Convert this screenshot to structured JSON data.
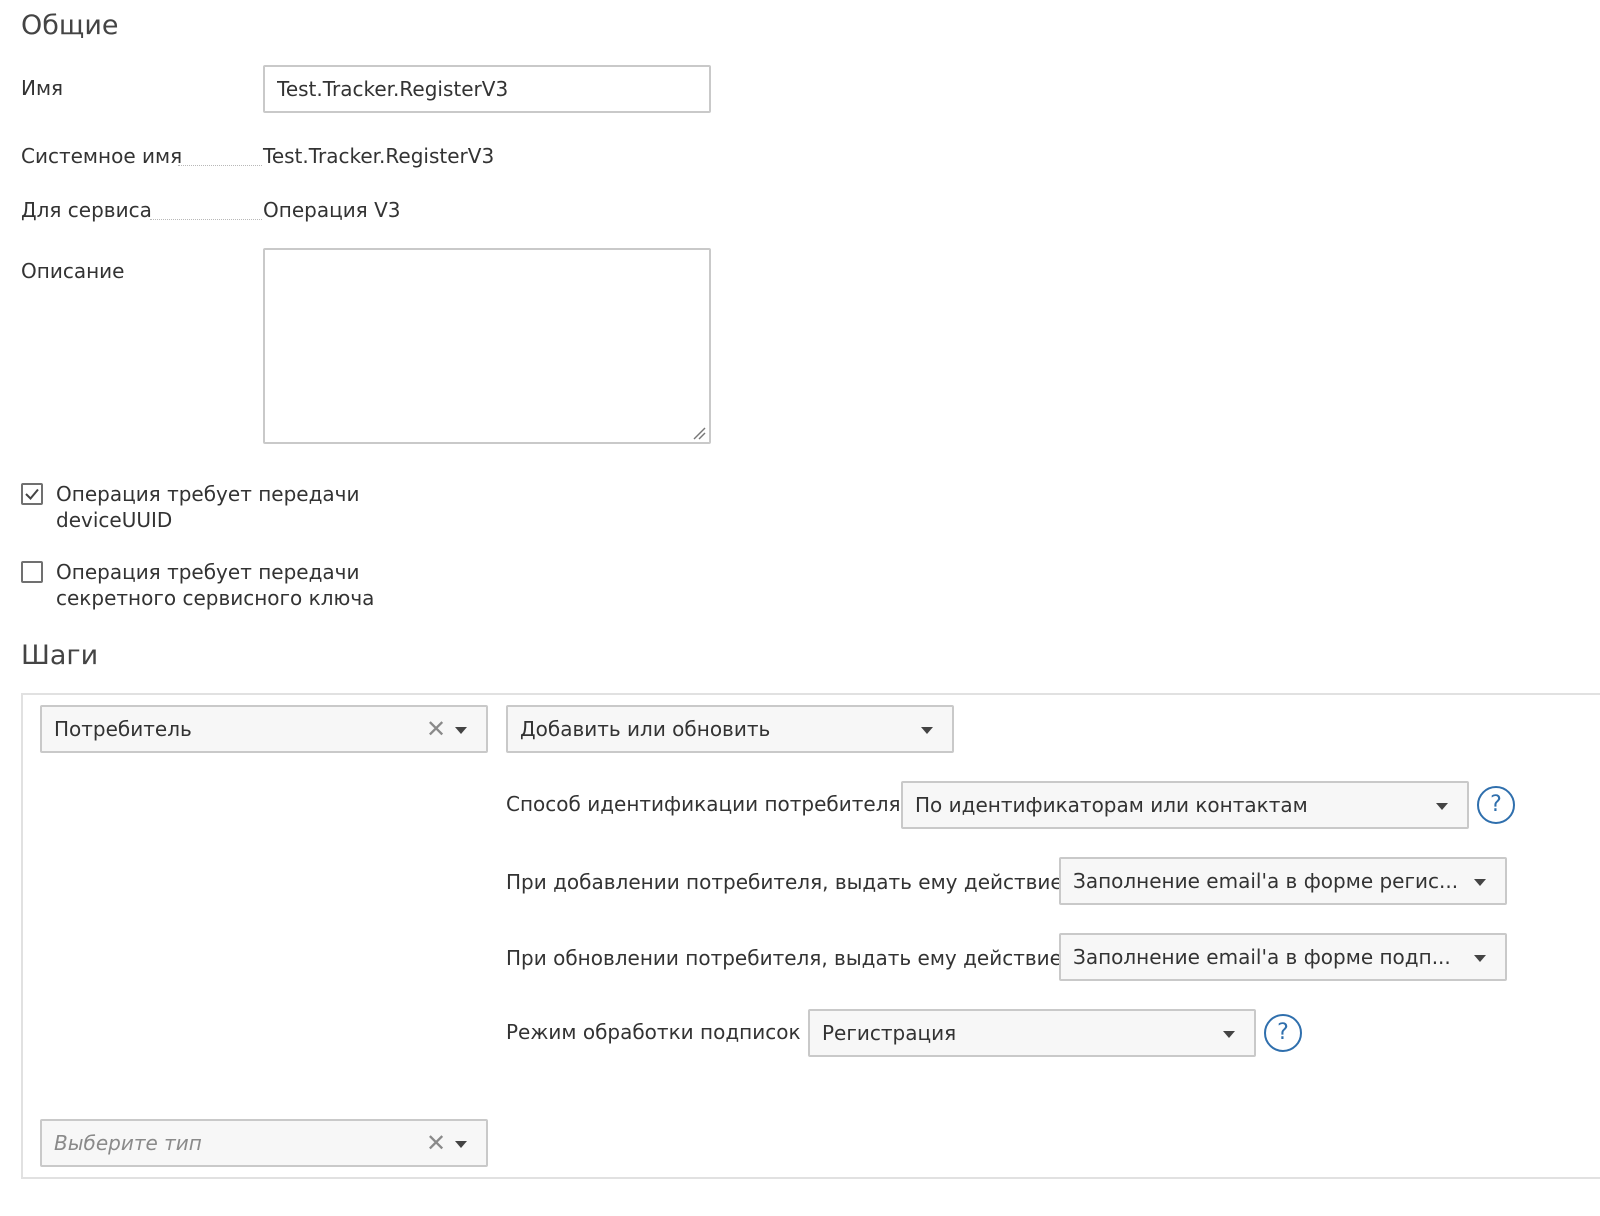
{
  "general": {
    "title": "Общие",
    "name_label": "Имя",
    "name_value": "Test.Tracker.RegisterV3",
    "system_name_label": "Системное имя",
    "system_name_value": "Test.Tracker.RegisterV3",
    "service_label": "Для сервиса",
    "service_value": "Операция V3",
    "description_label": "Описание",
    "description_value": "",
    "checkbox_device_uuid": {
      "line1": "Операция требует передачи",
      "line2": "deviceUUID",
      "checked": true
    },
    "checkbox_secret_key": {
      "line1": "Операция требует передачи",
      "line2": "секретного сервисного ключа",
      "checked": false
    }
  },
  "steps": {
    "title": "Шаги",
    "entity_select": "Потребитель",
    "action_select": "Добавить или обновить",
    "identification_label": "Способ идентификации потребителя",
    "identification_value": "По идентификаторам или контактам",
    "on_add_label": "При добавлении потребителя, выдать ему действие",
    "on_add_value": "Заполнение email'а в форме регис...",
    "on_update_label": "При обновлении потребителя, выдать ему действие",
    "on_update_value": "Заполнение email'а в форме подп...",
    "subscription_mode_label": "Режим обработки подписок",
    "subscription_mode_value": "Регистрация",
    "type_select_placeholder": "Выберите тип",
    "help_glyph": "?"
  },
  "icons": {
    "clear": "clear-icon",
    "dropdown": "chevron-down-icon",
    "help": "help-icon",
    "check": "check-icon"
  },
  "colors": {
    "help_icon": "#2f6fad",
    "border": "#c9c9c9",
    "select_bg": "#f7f7f7"
  }
}
